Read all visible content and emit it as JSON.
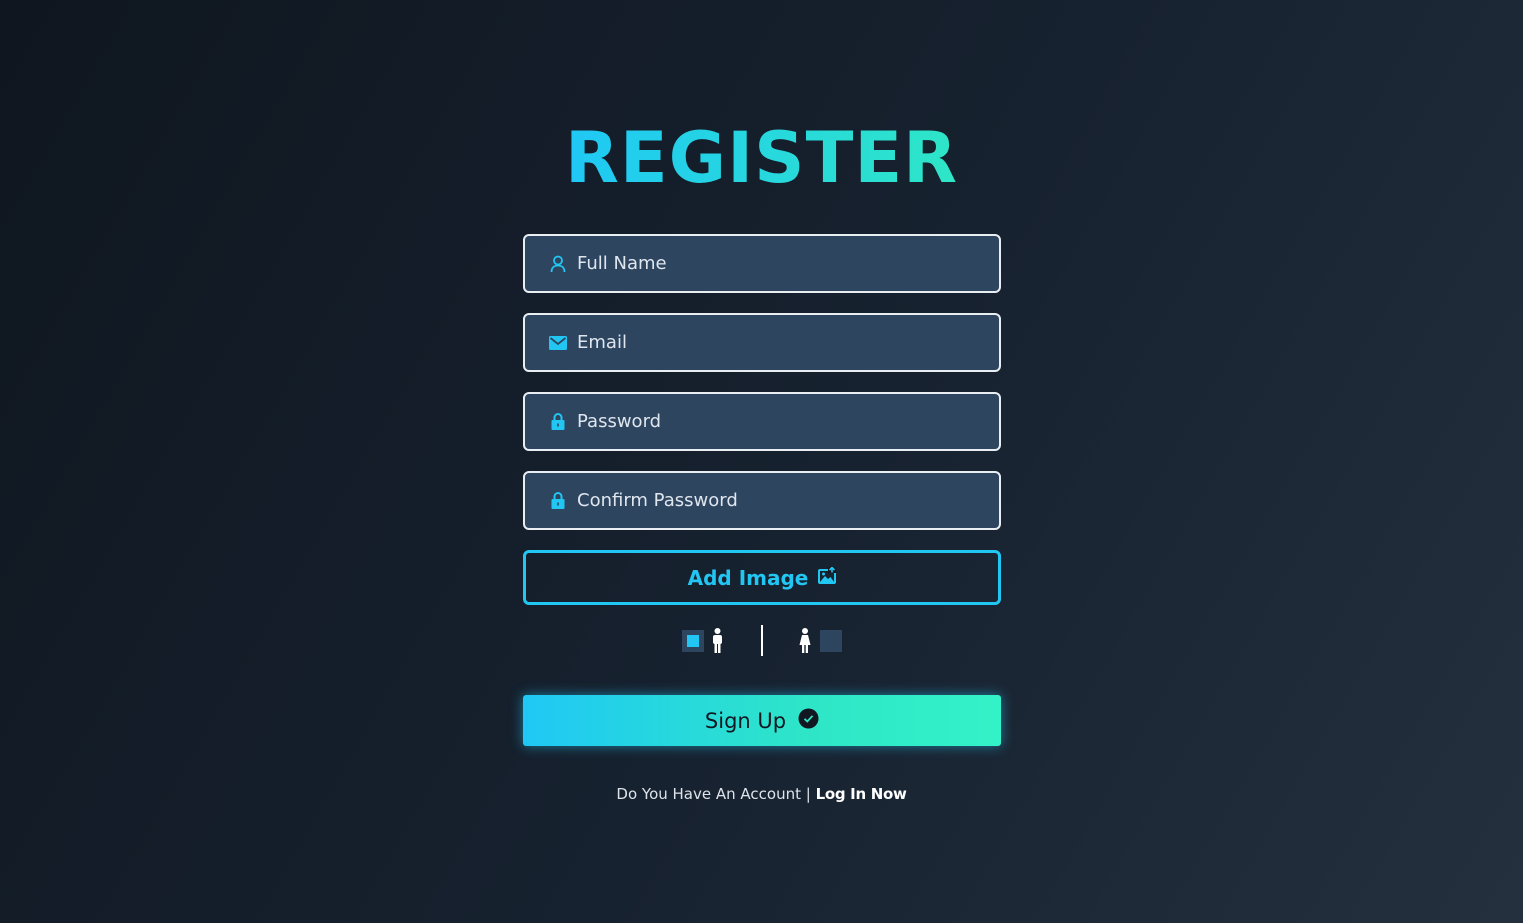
{
  "title": "REGISTER",
  "form": {
    "full_name": {
      "placeholder": "Full Name",
      "value": "",
      "icon": "user-icon"
    },
    "email": {
      "placeholder": "Email",
      "value": "",
      "icon": "envelope-icon"
    },
    "password": {
      "placeholder": "Password",
      "value": "",
      "icon": "lock-icon"
    },
    "confirm_password": {
      "placeholder": "Confirm Password",
      "value": "",
      "icon": "lock-icon"
    },
    "add_image": {
      "label": "Add Image",
      "icon": "image-upload-icon"
    },
    "gender": {
      "options": [
        {
          "icon": "male-icon",
          "checked": true
        },
        {
          "icon": "female-icon",
          "checked": false
        }
      ]
    },
    "submit": {
      "label": "Sign Up",
      "icon": "check-circle-icon"
    }
  },
  "footer": {
    "text": "Do You Have An Account | ",
    "link": "Log In Now"
  },
  "colors": {
    "accent": "#22c6f3",
    "accent_alt": "#2ee6c7",
    "field_bg": "#2e4560",
    "background": "#172230"
  }
}
